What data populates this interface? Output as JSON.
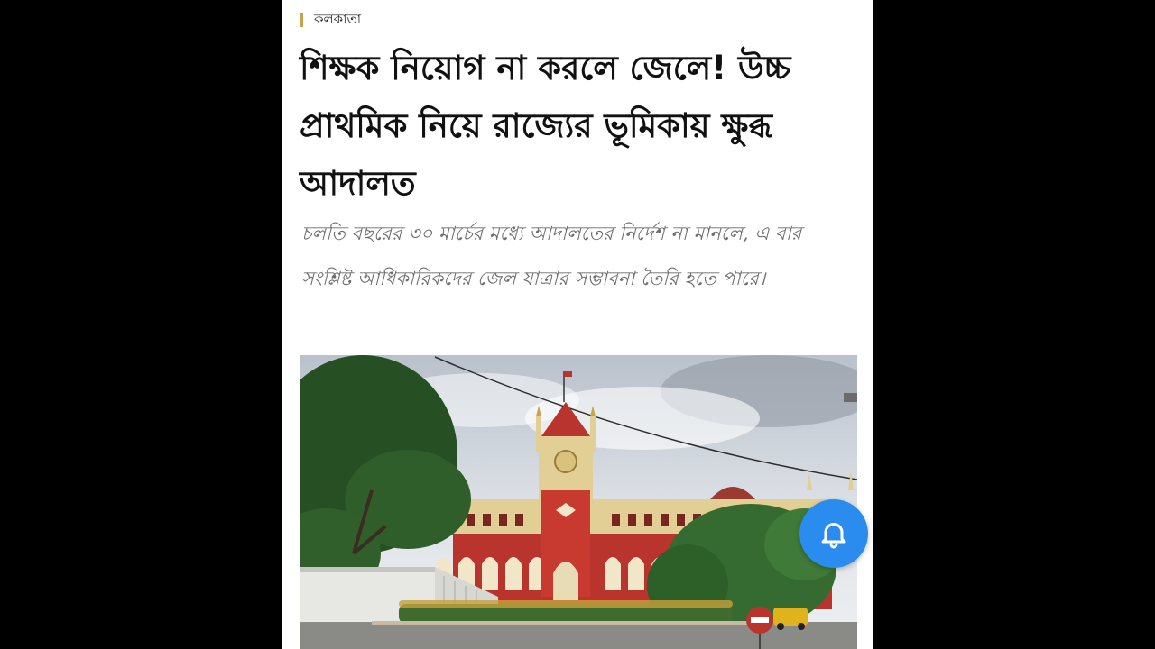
{
  "article": {
    "section": "কলকাতা",
    "headline": "শিক্ষক নিয়োগ না করলে জেলে! উচ্চ প্রাথমিক নিয়ে রাজ্যের ভূমিকায় ক্ষুব্ধ আদালত",
    "summary": "চলতি বছরের ৩০ মার্চের মধ্যে আদালতের নির্দেশ না মানলে, এ বার সংশ্লিষ্ট আধিকারিকদের জেল যাত্রার সম্ভাবনা তৈরি হতে পারে।"
  },
  "notification_button": {
    "icon": "bell-icon"
  },
  "colors": {
    "background": "#000000",
    "card": "#ffffff",
    "section_bar": "#c9a24a",
    "summary_text": "#6e6e6e",
    "notification_button": "#2b8cf0",
    "building_red": "#b8342c",
    "building_cream": "#e2cf95"
  }
}
